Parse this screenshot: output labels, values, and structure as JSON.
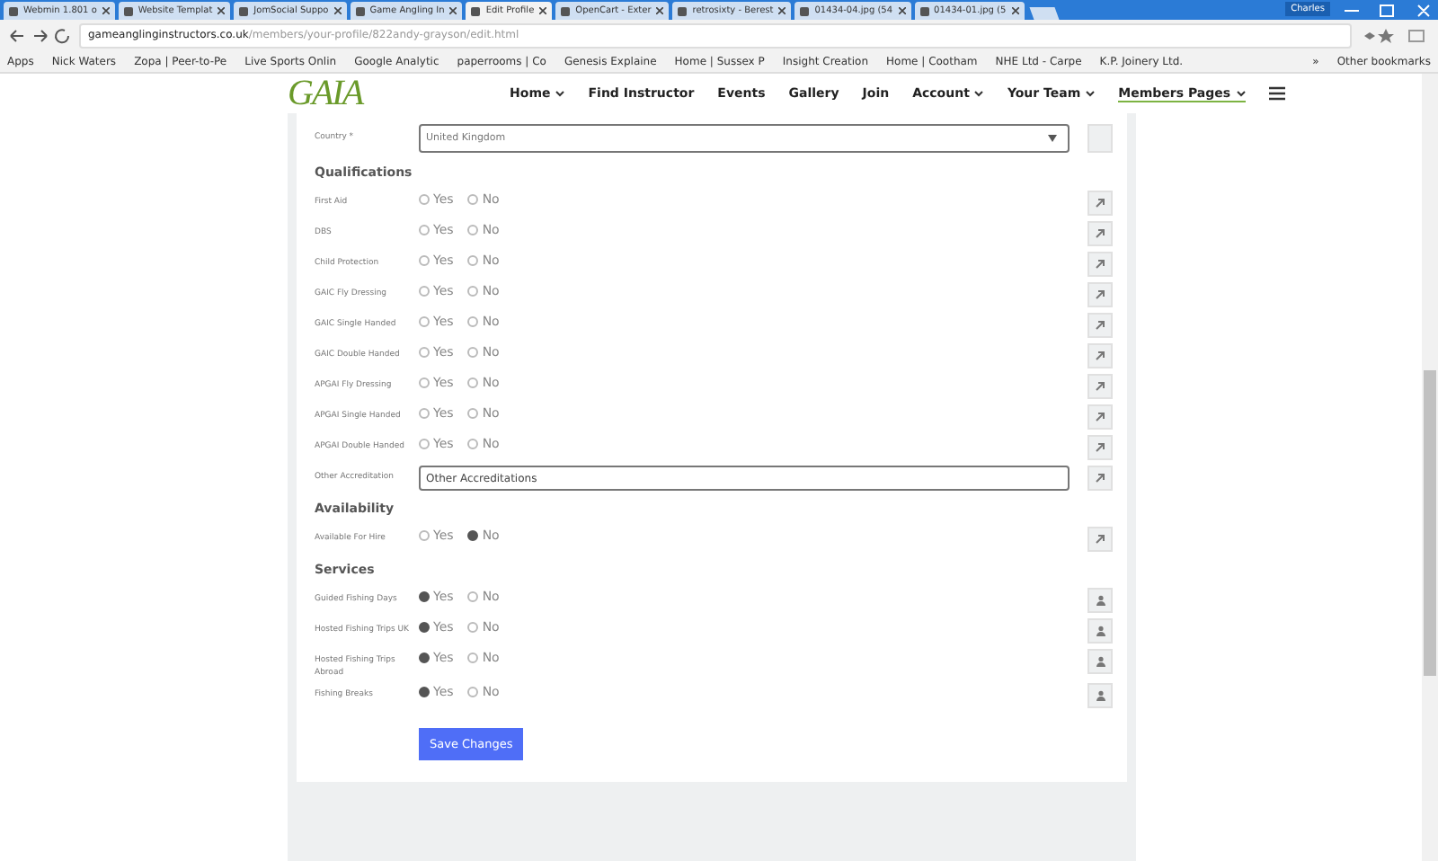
{
  "browser": {
    "tabs": [
      {
        "label": "Webmin 1.801 o",
        "selected": false
      },
      {
        "label": "Website Templat",
        "selected": false
      },
      {
        "label": "JomSocial Suppo",
        "selected": false
      },
      {
        "label": "Game Angling In",
        "selected": false
      },
      {
        "label": "Edit Profile",
        "selected": true
      },
      {
        "label": "OpenCart - Exter",
        "selected": false
      },
      {
        "label": "retrosixty - Berest",
        "selected": false
      },
      {
        "label": "01434-04.jpg (54",
        "selected": false
      },
      {
        "label": "01434-01.jpg (5",
        "selected": false
      }
    ],
    "profile": "Charles",
    "url_host": "gameanglinginstructors.co.uk",
    "url_path": "/members/your-profile/822andy-grayson/edit.html",
    "bookmarks": [
      "Apps",
      "Nick Waters",
      "Zopa | Peer-to-Pe",
      "Live Sports Onlin",
      "Google Analytic",
      "paperrooms | Co",
      "Genesis Explaine",
      "Home | Sussex P",
      "Insight Creation",
      "Home | Cootham",
      "NHE Ltd - Carpe",
      "K.P. Joinery Ltd."
    ],
    "bookmarks_more": "»",
    "other_bookmarks": "Other bookmarks"
  },
  "site": {
    "logo": "GAIA",
    "nav": [
      {
        "label": "Home",
        "dropdown": true,
        "selected": false
      },
      {
        "label": "Find Instructor",
        "dropdown": false,
        "selected": false
      },
      {
        "label": "Events",
        "dropdown": false,
        "selected": false
      },
      {
        "label": "Gallery",
        "dropdown": false,
        "selected": false
      },
      {
        "label": "Join",
        "dropdown": false,
        "selected": false
      },
      {
        "label": "Account",
        "dropdown": true,
        "selected": false
      },
      {
        "label": "Your Team",
        "dropdown": true,
        "selected": false
      },
      {
        "label": "Members Pages",
        "dropdown": true,
        "selected": true
      }
    ]
  },
  "form": {
    "country": {
      "label": "Country",
      "required": "*",
      "value": "United Kingdom"
    },
    "sections": [
      {
        "title": "Qualifications",
        "fields": [
          {
            "kind": "radio",
            "label": "First Aid",
            "options": [
              {
                "label": "Yes",
                "selected": false
              },
              {
                "label": "No",
                "selected": false
              }
            ]
          },
          {
            "kind": "radio",
            "label": "DBS",
            "options": [
              {
                "label": "Yes",
                "selected": false
              },
              {
                "label": "No",
                "selected": false
              }
            ]
          },
          {
            "kind": "radio",
            "label": "Child Protection",
            "options": [
              {
                "label": "Yes",
                "selected": false
              },
              {
                "label": "No",
                "selected": false
              }
            ]
          },
          {
            "kind": "radio",
            "label": "GAIC Fly Dressing",
            "options": [
              {
                "label": "Yes",
                "selected": false
              },
              {
                "label": "No",
                "selected": false
              }
            ]
          },
          {
            "kind": "radio",
            "label": "GAIC Single Handed",
            "options": [
              {
                "label": "Yes",
                "selected": false
              },
              {
                "label": "No",
                "selected": false
              }
            ]
          },
          {
            "kind": "radio",
            "label": "GAIC Double Handed",
            "options": [
              {
                "label": "Yes",
                "selected": false
              },
              {
                "label": "No",
                "selected": false
              }
            ]
          },
          {
            "kind": "radio",
            "label": "APGAI Fly Dressing",
            "options": [
              {
                "label": "Yes",
                "selected": false
              },
              {
                "label": "No",
                "selected": false
              }
            ]
          },
          {
            "kind": "radio",
            "label": "APGAI Single Handed",
            "options": [
              {
                "label": "Yes",
                "selected": false
              },
              {
                "label": "No",
                "selected": false
              }
            ]
          },
          {
            "kind": "radio",
            "label": "APGAI Double Handed",
            "options": [
              {
                "label": "Yes",
                "selected": false
              },
              {
                "label": "No",
                "selected": false
              }
            ]
          },
          {
            "kind": "text",
            "label": "Other Accreditation",
            "value": "Other Accreditations"
          }
        ]
      },
      {
        "title": "Availability",
        "fields": [
          {
            "kind": "radio",
            "label": "Available For Hire",
            "options": [
              {
                "label": "Yes",
                "selected": false
              },
              {
                "label": "No",
                "selected": true
              }
            ]
          }
        ]
      },
      {
        "title": "Services",
        "fields": [
          {
            "kind": "radio",
            "label": "Guided Fishing Days",
            "options": [
              {
                "label": "Yes",
                "selected": true
              },
              {
                "label": "No",
                "selected": false
              }
            ]
          },
          {
            "kind": "radio",
            "label": "Hosted Fishing Trips UK",
            "options": [
              {
                "label": "Yes",
                "selected": true
              },
              {
                "label": "No",
                "selected": false
              }
            ]
          },
          {
            "kind": "radio",
            "label": "Hosted Fishing Trips Abroad",
            "options": [
              {
                "label": "Yes",
                "selected": true
              },
              {
                "label": "No",
                "selected": false
              }
            ]
          },
          {
            "kind": "radio",
            "label": "Fishing Breaks",
            "options": [
              {
                "label": "Yes",
                "selected": true
              },
              {
                "label": "No",
                "selected": false
              }
            ]
          }
        ]
      }
    ],
    "save": "Save Changes"
  }
}
